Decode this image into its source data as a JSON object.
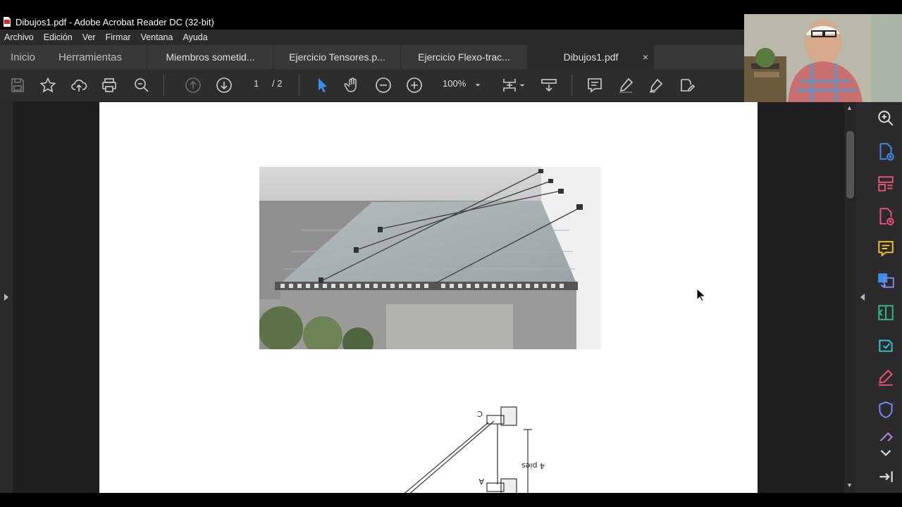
{
  "window": {
    "title": "Dibujos1.pdf - Adobe Acrobat Reader DC (32-bit)"
  },
  "menu": [
    "Archivo",
    "Edición",
    "Ver",
    "Firmar",
    "Ventana",
    "Ayuda"
  ],
  "nav": {
    "home": "Inicio",
    "tools": "Herramientas"
  },
  "tabs": [
    {
      "label": "Miembros sometid..."
    },
    {
      "label": "Ejercicio Tensores.p..."
    },
    {
      "label": "Ejercicio Flexo-trac..."
    },
    {
      "label": "Dibujos1.pdf",
      "active": true,
      "close": "×"
    }
  ],
  "toolbar": {
    "current_page": "1",
    "total_pages": "/ 2",
    "zoom": "100%"
  },
  "document": {
    "diagram_labels": {
      "c": "C",
      "a": "A",
      "dimension": "4 pies"
    }
  },
  "icons": {
    "save": "save-icon",
    "bookmark": "star-icon",
    "upload": "cloud-upload-icon",
    "print": "print-icon",
    "search": "zoom-search-icon",
    "prev_page": "arrow-up-circle-icon",
    "next_page": "arrow-down-circle-icon",
    "select": "pointer-icon",
    "hand": "hand-icon",
    "zoom_out": "minus-circle-icon",
    "zoom_in": "plus-circle-icon",
    "fit": "fit-page-icon",
    "scroll_mode": "scroll-mode-icon",
    "comment": "comment-icon",
    "highlight": "highlight-pen-icon",
    "draw": "draw-icon",
    "share": "share-sign-icon"
  },
  "colors": {
    "accent_blue": "#3d8ee8",
    "pink": "#e8517a",
    "green": "#2eb88a",
    "yellow": "#f2c12e",
    "purple": "#b388f5",
    "cyan": "#2ec4d6"
  }
}
